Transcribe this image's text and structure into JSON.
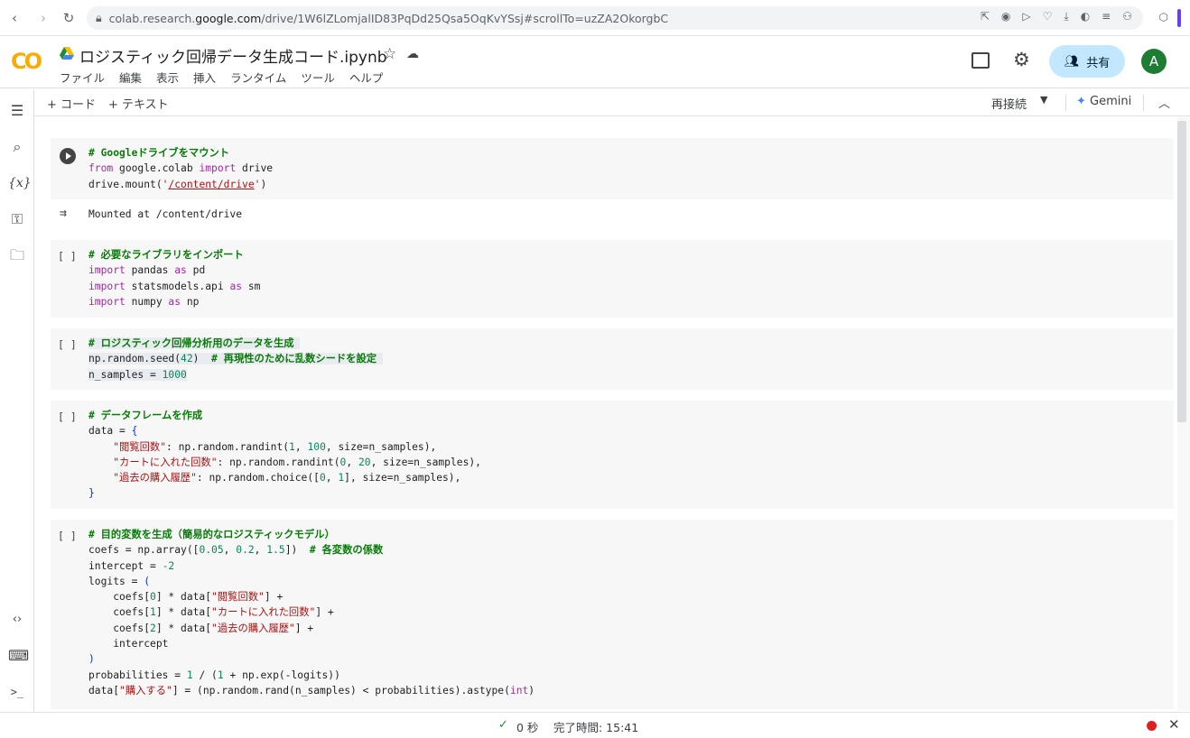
{
  "browser": {
    "url_domain_prefix": "colab.research.",
    "url_domain": "google.com",
    "url_path": "/drive/1W6lZLomjalID83PqDd25Qsa5OqKvYSsj#scrollTo=uzZA2OkorgbC"
  },
  "app": {
    "logo_text": "CO",
    "title": "ロジスティック回帰データ生成コード.ipynb",
    "menu": [
      "ファイル",
      "編集",
      "表示",
      "挿入",
      "ランタイム",
      "ツール",
      "ヘルプ"
    ],
    "share_label": "共有",
    "avatar_letter": "A"
  },
  "toolbar": {
    "add_code": "+ コード",
    "add_text": "+ テキスト",
    "reconnect": "再接続",
    "gemini": "Gemini"
  },
  "output": {
    "mount": "Mounted at /content/drive"
  },
  "status": {
    "elapsed": "0 秒",
    "completed": "完了時間: 15:41"
  },
  "icons": [
    "back-icon",
    "forward-icon",
    "reload-icon",
    "lock-icon",
    "share-page-icon",
    "camera-icon",
    "cast-icon",
    "heart-icon",
    "download-icon",
    "toggle-icon",
    "list-icon",
    "profile-icon",
    "extension-icon",
    "drive-icon",
    "star-icon",
    "cloud-icon",
    "comment-icon",
    "gear-icon",
    "people-icon",
    "toc-icon",
    "search-icon",
    "variables-icon",
    "key-icon",
    "folder-icon",
    "code-snippets-icon",
    "terminal-icon",
    "command-palette-icon",
    "run-icon",
    "output-icon",
    "check-icon",
    "record-icon",
    "close-icon"
  ]
}
